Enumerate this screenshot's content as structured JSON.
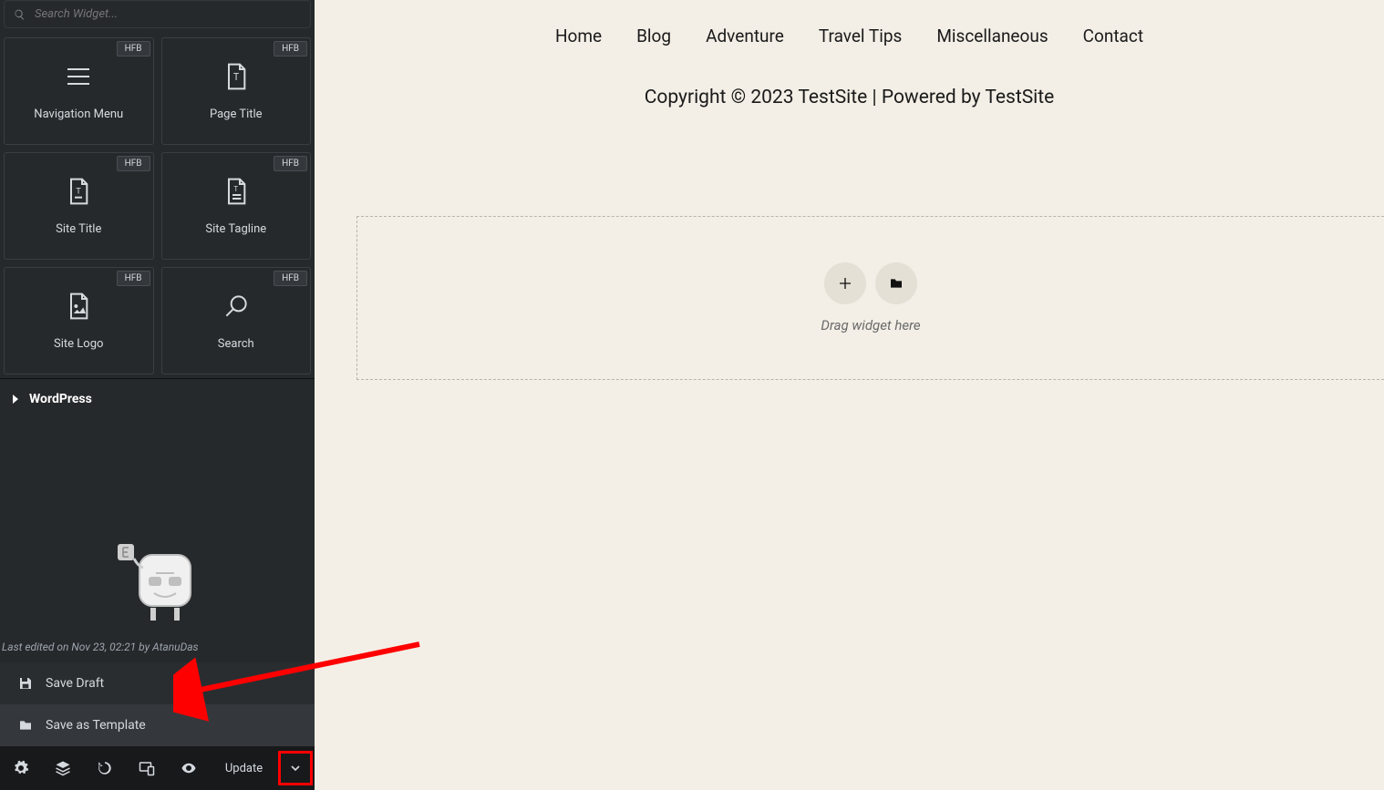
{
  "search": {
    "placeholder": "Search Widget..."
  },
  "widgets": [
    {
      "label": "Navigation Menu",
      "badge": "HFB",
      "icon": "hamburger"
    },
    {
      "label": "Page Title",
      "badge": "HFB",
      "icon": "doc-t"
    },
    {
      "label": "Site Title",
      "badge": "HFB",
      "icon": "doc-title"
    },
    {
      "label": "Site Tagline",
      "badge": "HFB",
      "icon": "doc-lines"
    },
    {
      "label": "Site Logo",
      "badge": "HFB",
      "icon": "doc-image"
    },
    {
      "label": "Search",
      "badge": "HFB",
      "icon": "magnifier"
    }
  ],
  "accordion": {
    "label": "WordPress"
  },
  "last_edited": "Last edited on Nov 23, 02:21 by AtanuDas",
  "save_menu": {
    "draft": "Save Draft",
    "template": "Save as Template"
  },
  "bottom_bar": {
    "update": "Update"
  },
  "site": {
    "nav": [
      "Home",
      "Blog",
      "Adventure",
      "Travel Tips",
      "Miscellaneous",
      "Contact"
    ],
    "copyright": "Copyright © 2023 TestSite | Powered by TestSite"
  },
  "drop_zone": {
    "text": "Drag widget here"
  }
}
